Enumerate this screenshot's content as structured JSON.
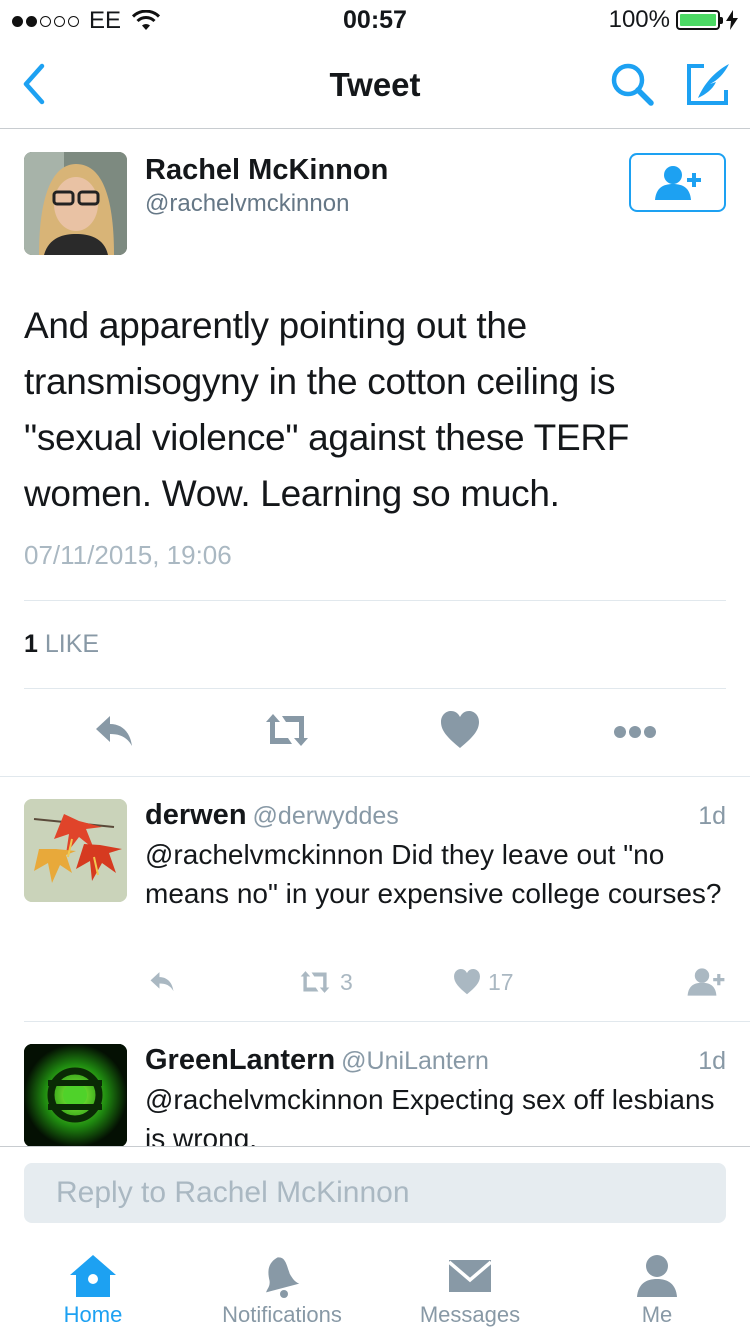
{
  "status_bar": {
    "carrier": "EE",
    "time": "00:57",
    "battery_percent": "100%",
    "signal_dots_filled": 2,
    "signal_dots_total": 5
  },
  "nav": {
    "title": "Tweet"
  },
  "main_tweet": {
    "author_name": "Rachel McKinnon",
    "author_handle": "@rachelvmckinnon",
    "text": "And apparently pointing out the transmisogyny in the cotton ceiling is \"sexual violence\" against these TERF women. Wow. Learning so much.",
    "timestamp": "07/11/2015, 19:06",
    "like_count": "1",
    "like_label": "LIKE"
  },
  "replies": [
    {
      "name": "derwen",
      "handle": "@derwyddes",
      "time": "1d",
      "text": "@rachelvmckinnon Did they leave out \"no means no\" in your expensive college courses?",
      "retweets": "3",
      "likes": "17"
    },
    {
      "name": "GreenLantern",
      "handle": "@UniLantern",
      "time": "1d",
      "text": "@rachelvmckinnon Expecting sex off lesbians is wrong."
    }
  ],
  "composer": {
    "placeholder": "Reply to Rachel McKinnon"
  },
  "tabs": [
    {
      "label": "Home",
      "icon": "home-icon",
      "active": true
    },
    {
      "label": "Notifications",
      "icon": "bell-icon",
      "active": false
    },
    {
      "label": "Messages",
      "icon": "envelope-icon",
      "active": false
    },
    {
      "label": "Me",
      "icon": "person-icon",
      "active": false
    }
  ],
  "colors": {
    "accent": "#1da1f2",
    "icon_gray": "#8899a6",
    "light_gray": "#aab8c2",
    "battery_green": "#4cd964"
  }
}
